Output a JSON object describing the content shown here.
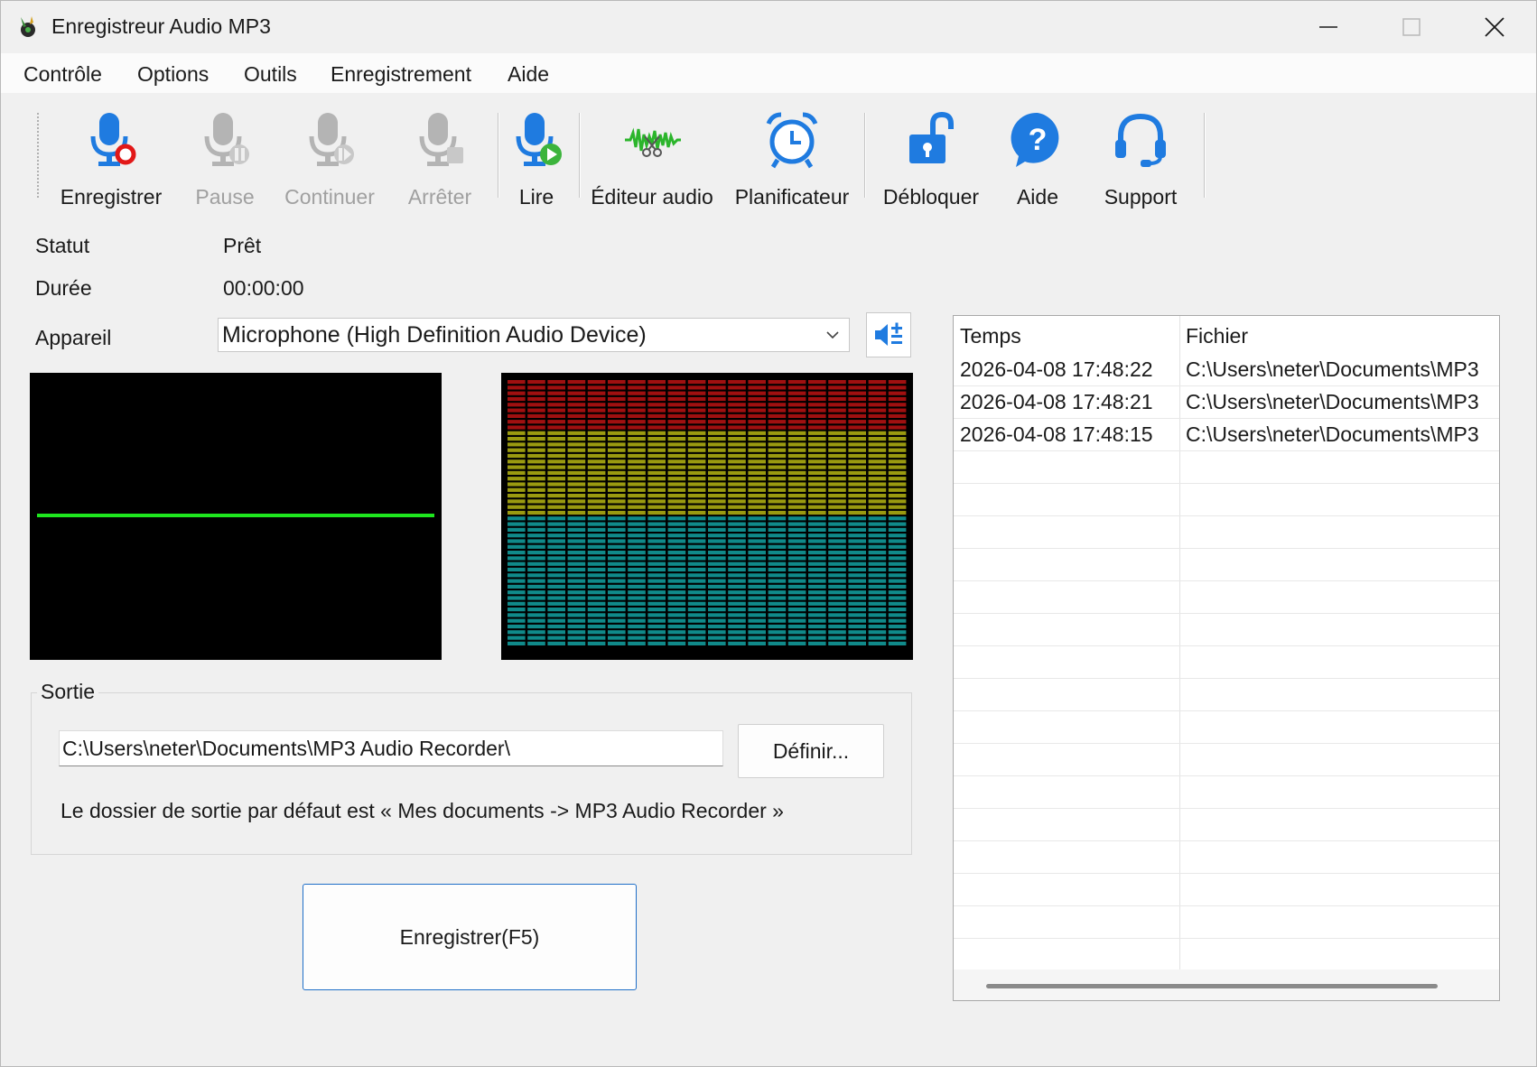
{
  "window": {
    "title": "Enregistreur Audio MP3"
  },
  "menu": [
    "Contrôle",
    "Options",
    "Outils",
    "Enregistrement",
    "Aide"
  ],
  "toolbar": {
    "record": "Enregistrer",
    "pause": "Pause",
    "continue": "Continuer",
    "stop": "Arrêter",
    "play": "Lire",
    "editor": "Éditeur audio",
    "scheduler": "Planificateur",
    "unlock": "Débloquer",
    "help": "Aide",
    "support": "Support"
  },
  "status": {
    "status_label": "Statut",
    "status_value": "Prêt",
    "duration_label": "Durée",
    "duration_value": "00:00:00",
    "device_label": "Appareil",
    "device_value": "Microphone (High Definition Audio Device)"
  },
  "output": {
    "group_title": "Sortie",
    "path": "C:\\Users\\neter\\Documents\\MP3 Audio Recorder\\",
    "define_button": "Définir...",
    "hint": "Le dossier de sortie par défaut est « Mes documents -> MP3 Audio Recorder »"
  },
  "record_button": "Enregistrer(F5)",
  "history": {
    "columns": [
      "Temps",
      "Fichier"
    ],
    "rows": [
      {
        "time": "2026-04-08 17:48:22",
        "file": "C:\\Users\\neter\\Documents\\MP3"
      },
      {
        "time": "2026-04-08 17:48:21",
        "file": "C:\\Users\\neter\\Documents\\MP3"
      },
      {
        "time": "2026-04-08 17:48:15",
        "file": "C:\\Users\\neter\\Documents\\MP3"
      }
    ]
  },
  "colors": {
    "accent_blue": "#1f7be0",
    "scope_trace": "#1ee61e",
    "meter_red": "#a01010",
    "meter_yellow": "#9a9a10",
    "meter_teal": "#108a8a"
  },
  "icons": {
    "app": "app-icon",
    "record": "mic-record-icon",
    "pause": "mic-pause-icon",
    "continue": "mic-continue-icon",
    "stop": "mic-stop-icon",
    "play": "mic-play-icon",
    "editor": "audio-editor-icon",
    "scheduler": "alarm-clock-icon",
    "unlock": "unlock-icon",
    "help": "help-icon",
    "support": "headset-icon",
    "volume": "volume-plus-icon"
  }
}
